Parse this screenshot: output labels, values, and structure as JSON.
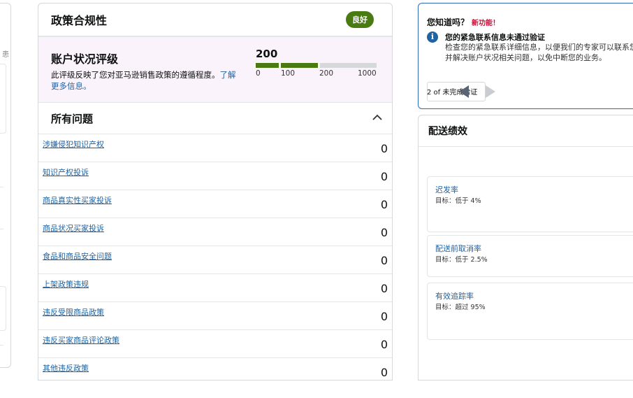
{
  "left_panel": {
    "fragment": "患"
  },
  "policy": {
    "title": "政策合规性",
    "status_badge": "良好",
    "rating": {
      "title": "账户状况评级",
      "description": "此评级反映了您对亚马逊销售政策的遵循程度。",
      "learn_more": "了解更多信息。",
      "score": "200",
      "score_value": 200,
      "scale_ticks": [
        "0",
        "100",
        "200",
        "1000"
      ],
      "colors": {
        "filled": "#4a7b12",
        "empty": "#d5d9d9"
      }
    },
    "issues": {
      "title": "所有问题",
      "rows": [
        {
          "label": "涉嫌侵犯知识产权",
          "count": "0"
        },
        {
          "label": "知识产权投诉",
          "count": "0"
        },
        {
          "label": "商品真实性买家投诉",
          "count": "0"
        },
        {
          "label": "商品状况买家投诉",
          "count": "0"
        },
        {
          "label": "食品和商品安全问题",
          "count": "0"
        },
        {
          "label": "上架政策违规",
          "count": "0"
        },
        {
          "label": "违反受限商品政策",
          "count": "0"
        },
        {
          "label": "违反买家商品评论政策",
          "count": "0"
        },
        {
          "label": "其他违反政策",
          "count": "0"
        }
      ]
    }
  },
  "did_you_know": {
    "title": "您知道吗？",
    "new_label": "新功能！",
    "message_title": "您的紧急联系信息未通过验证",
    "message_body": "检查您的紧急联系详细信息，以便我们的专家可以联系您并解决账户状况相关问题，以免中断您的业务。",
    "pager_text": "2 of 未完成验证",
    "icons": [
      "info-icon",
      "arrow-left-icon",
      "arrow-right-icon"
    ]
  },
  "delivery": {
    "title": "配送绩效",
    "metrics": [
      {
        "name": "迟发率",
        "target": "目标：低于 4%"
      },
      {
        "name": "配送前取消率",
        "target": "目标：低于 2.5%"
      },
      {
        "name": "有效追踪率",
        "target": "目标：超过 95%"
      }
    ]
  }
}
